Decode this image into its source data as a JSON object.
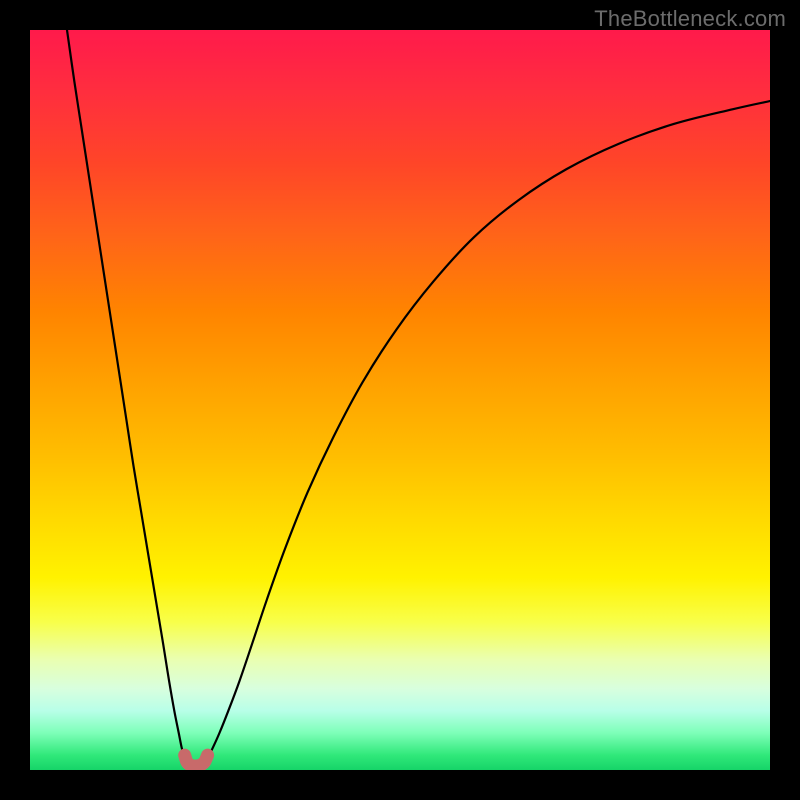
{
  "watermark": "TheBottleneck.com",
  "colors": {
    "frame": "#000000",
    "curve_stroke": "#000000",
    "marker_stroke": "#c86a6a",
    "gradient_top": "#ff1a4b",
    "gradient_bottom": "#16d468"
  },
  "chart_data": {
    "type": "line",
    "title": "",
    "xlabel": "",
    "ylabel": "",
    "xlim": [
      0,
      100
    ],
    "ylim": [
      0,
      100
    ],
    "grid": false,
    "legend": false,
    "annotations": [
      "TheBottleneck.com"
    ],
    "series": [
      {
        "name": "left-branch",
        "x": [
          5,
          6,
          7,
          8,
          9,
          10,
          11,
          12,
          13,
          14,
          15,
          16,
          17,
          18,
          18.8,
          19.5,
          20.1,
          20.5,
          20.9,
          21.2
        ],
        "y": [
          100,
          93,
          86.5,
          80,
          73.5,
          67,
          60.5,
          54,
          47.5,
          41,
          35,
          29,
          23,
          17,
          12,
          8,
          5,
          3,
          1.5,
          0.8
        ]
      },
      {
        "name": "right-branch",
        "x": [
          23.5,
          24,
          24.7,
          25.6,
          26.8,
          28.3,
          30,
          32,
          34.5,
          37.5,
          41,
          45,
          49.5,
          54.5,
          60,
          66,
          72.5,
          79.5,
          87,
          95,
          100
        ],
        "y": [
          0.8,
          1.6,
          3,
          5,
          8,
          12,
          17,
          23,
          30,
          37.5,
          45,
          52.5,
          59.5,
          66,
          72,
          77,
          81.2,
          84.6,
          87.3,
          89.3,
          90.4
        ]
      },
      {
        "name": "valley-marker",
        "x": [
          20.9,
          21.2,
          21.6,
          22.1,
          22.6,
          23.1,
          23.6,
          24.0
        ],
        "y": [
          2.0,
          1.1,
          0.7,
          0.55,
          0.55,
          0.7,
          1.1,
          2.0
        ]
      }
    ],
    "minimum": {
      "x": 22.3,
      "y": 0.5
    }
  }
}
